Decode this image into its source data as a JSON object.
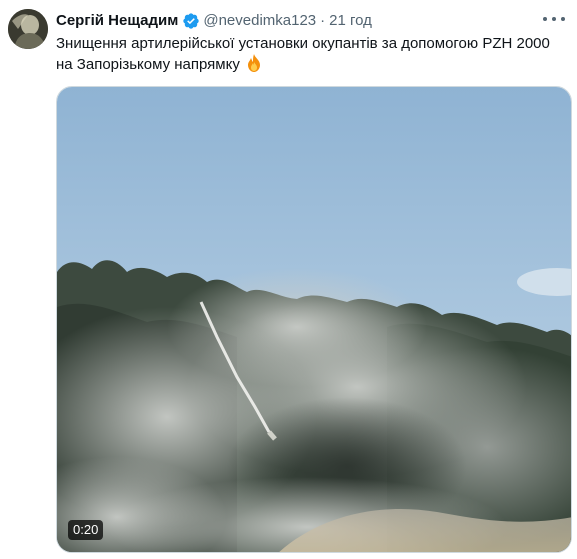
{
  "tweet": {
    "author": {
      "display_name": "Сергій Нещадим",
      "handle": "@nevedimka123",
      "verified": true,
      "verified_color": "#1d9bf0"
    },
    "separator": "·",
    "timestamp": "21 год",
    "text": "Знищення артилерійської установки окупантів за допомогою PZH 2000 на Запорізькому напрямку",
    "text_emoji": "fire-emoji",
    "media": {
      "type": "video",
      "duration": "0:20"
    }
  },
  "colors": {
    "text_primary": "#0f1419",
    "text_secondary": "#536471",
    "border": "#cfd9de"
  }
}
